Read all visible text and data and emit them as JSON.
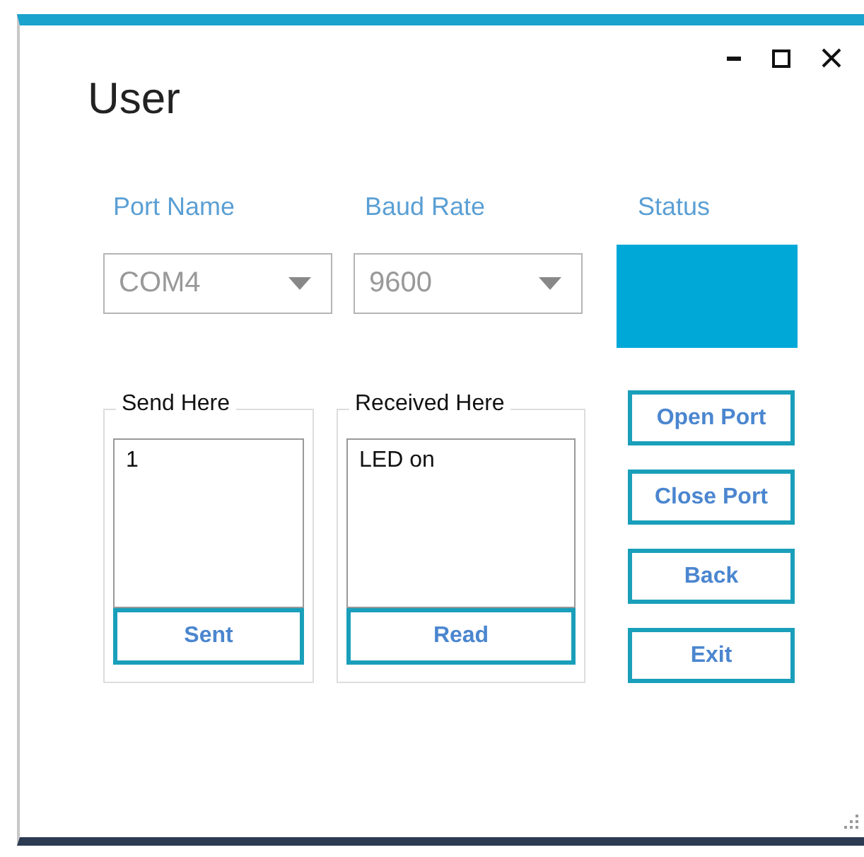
{
  "window": {
    "title": "User"
  },
  "settings": [
    {
      "label": "Port Name",
      "value": "COM4"
    },
    {
      "label": "Baud Rate",
      "value": "9600"
    }
  ],
  "status": {
    "label": "Status",
    "color": "#00a8d8"
  },
  "panels": [
    {
      "title": "Send Here",
      "text": "1",
      "button": "Sent"
    },
    {
      "title": "Received Here",
      "text": "LED on",
      "button": "Read"
    }
  ],
  "buttons": [
    "Open Port",
    "Close Port",
    "Back",
    "Exit"
  ]
}
